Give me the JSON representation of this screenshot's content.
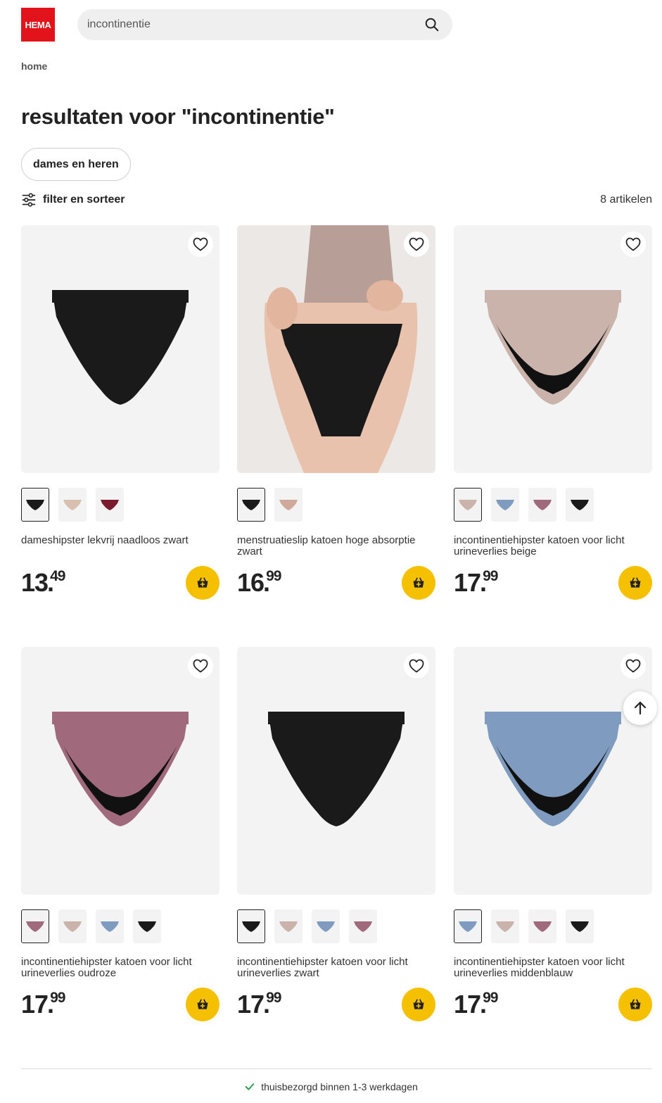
{
  "brand": {
    "logo_text": "HEMA",
    "color": "#e3131b"
  },
  "search": {
    "value": "incontinentie",
    "button_icon": "search-icon"
  },
  "breadcrumb": {
    "home": "home"
  },
  "page": {
    "title": "resultaten voor \"incontinentie\""
  },
  "filters": {
    "chip_label": "dames en heren",
    "filter_label": "filter en sorteer",
    "filter_icon": "sliders-icon",
    "count": "8 artikelen"
  },
  "products": [
    {
      "name": "dameshipster lekvrij naadloos zwart",
      "price_int": "13",
      "price_dec": "49",
      "swatches": [
        {
          "color": "#1a1a1a",
          "selected": true
        },
        {
          "color": "#d9bfaf",
          "selected": false
        },
        {
          "color": "#7a1c2e",
          "selected": false
        }
      ]
    },
    {
      "name": "menstruatieslip katoen hoge absorptie zwart",
      "price_int": "16",
      "price_dec": "99",
      "swatches": [
        {
          "color": "#1a1a1a",
          "selected": true
        },
        {
          "color": "#cfa99a",
          "selected": false
        }
      ]
    },
    {
      "name": "incontinentiehipster katoen voor licht urineverlies beige",
      "price_int": "17",
      "price_dec": "99",
      "swatches": [
        {
          "color": "#c9b3ab",
          "selected": true
        },
        {
          "color": "#7f9bbf",
          "selected": false
        },
        {
          "color": "#a06a7c",
          "selected": false
        },
        {
          "color": "#1a1a1a",
          "selected": false
        }
      ]
    },
    {
      "name": "incontinentiehipster katoen voor licht urineverlies oudroze",
      "price_int": "17",
      "price_dec": "99",
      "swatches": [
        {
          "color": "#a06a7c",
          "selected": true
        },
        {
          "color": "#c9b3ab",
          "selected": false
        },
        {
          "color": "#7f9bbf",
          "selected": false
        },
        {
          "color": "#1a1a1a",
          "selected": false
        }
      ]
    },
    {
      "name": "incontinentiehipster katoen voor licht urineverlies zwart",
      "price_int": "17",
      "price_dec": "99",
      "swatches": [
        {
          "color": "#1a1a1a",
          "selected": true
        },
        {
          "color": "#c9b3ab",
          "selected": false
        },
        {
          "color": "#7f9bbf",
          "selected": false
        },
        {
          "color": "#a06a7c",
          "selected": false
        }
      ]
    },
    {
      "name": "incontinentiehipster katoen voor licht urineverlies middenblauw",
      "price_int": "17",
      "price_dec": "99",
      "swatches": [
        {
          "color": "#7f9bbf",
          "selected": true
        },
        {
          "color": "#c9b3ab",
          "selected": false
        },
        {
          "color": "#a06a7c",
          "selected": false
        },
        {
          "color": "#1a1a1a",
          "selected": false
        }
      ]
    }
  ],
  "footer": {
    "delivery": "thuisbezorgd binnen 1-3 werkdagen",
    "check_color": "#2e9e4f"
  },
  "colors": {
    "cart_button": "#f5c000"
  }
}
